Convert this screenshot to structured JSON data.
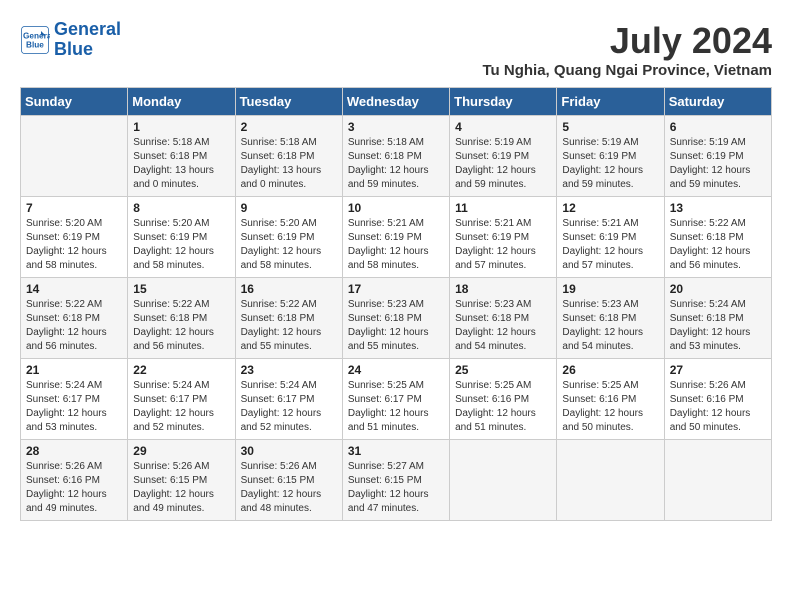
{
  "header": {
    "logo_line1": "General",
    "logo_line2": "Blue",
    "month_year": "July 2024",
    "location": "Tu Nghia, Quang Ngai Province, Vietnam"
  },
  "days_of_week": [
    "Sunday",
    "Monday",
    "Tuesday",
    "Wednesday",
    "Thursday",
    "Friday",
    "Saturday"
  ],
  "weeks": [
    [
      {
        "day": "",
        "info": ""
      },
      {
        "day": "1",
        "info": "Sunrise: 5:18 AM\nSunset: 6:18 PM\nDaylight: 13 hours\nand 0 minutes."
      },
      {
        "day": "2",
        "info": "Sunrise: 5:18 AM\nSunset: 6:18 PM\nDaylight: 13 hours\nand 0 minutes."
      },
      {
        "day": "3",
        "info": "Sunrise: 5:18 AM\nSunset: 6:18 PM\nDaylight: 12 hours\nand 59 minutes."
      },
      {
        "day": "4",
        "info": "Sunrise: 5:19 AM\nSunset: 6:19 PM\nDaylight: 12 hours\nand 59 minutes."
      },
      {
        "day": "5",
        "info": "Sunrise: 5:19 AM\nSunset: 6:19 PM\nDaylight: 12 hours\nand 59 minutes."
      },
      {
        "day": "6",
        "info": "Sunrise: 5:19 AM\nSunset: 6:19 PM\nDaylight: 12 hours\nand 59 minutes."
      }
    ],
    [
      {
        "day": "7",
        "info": "Sunrise: 5:20 AM\nSunset: 6:19 PM\nDaylight: 12 hours\nand 58 minutes."
      },
      {
        "day": "8",
        "info": "Sunrise: 5:20 AM\nSunset: 6:19 PM\nDaylight: 12 hours\nand 58 minutes."
      },
      {
        "day": "9",
        "info": "Sunrise: 5:20 AM\nSunset: 6:19 PM\nDaylight: 12 hours\nand 58 minutes."
      },
      {
        "day": "10",
        "info": "Sunrise: 5:21 AM\nSunset: 6:19 PM\nDaylight: 12 hours\nand 58 minutes."
      },
      {
        "day": "11",
        "info": "Sunrise: 5:21 AM\nSunset: 6:19 PM\nDaylight: 12 hours\nand 57 minutes."
      },
      {
        "day": "12",
        "info": "Sunrise: 5:21 AM\nSunset: 6:19 PM\nDaylight: 12 hours\nand 57 minutes."
      },
      {
        "day": "13",
        "info": "Sunrise: 5:22 AM\nSunset: 6:18 PM\nDaylight: 12 hours\nand 56 minutes."
      }
    ],
    [
      {
        "day": "14",
        "info": "Sunrise: 5:22 AM\nSunset: 6:18 PM\nDaylight: 12 hours\nand 56 minutes."
      },
      {
        "day": "15",
        "info": "Sunrise: 5:22 AM\nSunset: 6:18 PM\nDaylight: 12 hours\nand 56 minutes."
      },
      {
        "day": "16",
        "info": "Sunrise: 5:22 AM\nSunset: 6:18 PM\nDaylight: 12 hours\nand 55 minutes."
      },
      {
        "day": "17",
        "info": "Sunrise: 5:23 AM\nSunset: 6:18 PM\nDaylight: 12 hours\nand 55 minutes."
      },
      {
        "day": "18",
        "info": "Sunrise: 5:23 AM\nSunset: 6:18 PM\nDaylight: 12 hours\nand 54 minutes."
      },
      {
        "day": "19",
        "info": "Sunrise: 5:23 AM\nSunset: 6:18 PM\nDaylight: 12 hours\nand 54 minutes."
      },
      {
        "day": "20",
        "info": "Sunrise: 5:24 AM\nSunset: 6:18 PM\nDaylight: 12 hours\nand 53 minutes."
      }
    ],
    [
      {
        "day": "21",
        "info": "Sunrise: 5:24 AM\nSunset: 6:17 PM\nDaylight: 12 hours\nand 53 minutes."
      },
      {
        "day": "22",
        "info": "Sunrise: 5:24 AM\nSunset: 6:17 PM\nDaylight: 12 hours\nand 52 minutes."
      },
      {
        "day": "23",
        "info": "Sunrise: 5:24 AM\nSunset: 6:17 PM\nDaylight: 12 hours\nand 52 minutes."
      },
      {
        "day": "24",
        "info": "Sunrise: 5:25 AM\nSunset: 6:17 PM\nDaylight: 12 hours\nand 51 minutes."
      },
      {
        "day": "25",
        "info": "Sunrise: 5:25 AM\nSunset: 6:16 PM\nDaylight: 12 hours\nand 51 minutes."
      },
      {
        "day": "26",
        "info": "Sunrise: 5:25 AM\nSunset: 6:16 PM\nDaylight: 12 hours\nand 50 minutes."
      },
      {
        "day": "27",
        "info": "Sunrise: 5:26 AM\nSunset: 6:16 PM\nDaylight: 12 hours\nand 50 minutes."
      }
    ],
    [
      {
        "day": "28",
        "info": "Sunrise: 5:26 AM\nSunset: 6:16 PM\nDaylight: 12 hours\nand 49 minutes."
      },
      {
        "day": "29",
        "info": "Sunrise: 5:26 AM\nSunset: 6:15 PM\nDaylight: 12 hours\nand 49 minutes."
      },
      {
        "day": "30",
        "info": "Sunrise: 5:26 AM\nSunset: 6:15 PM\nDaylight: 12 hours\nand 48 minutes."
      },
      {
        "day": "31",
        "info": "Sunrise: 5:27 AM\nSunset: 6:15 PM\nDaylight: 12 hours\nand 47 minutes."
      },
      {
        "day": "",
        "info": ""
      },
      {
        "day": "",
        "info": ""
      },
      {
        "day": "",
        "info": ""
      }
    ]
  ]
}
